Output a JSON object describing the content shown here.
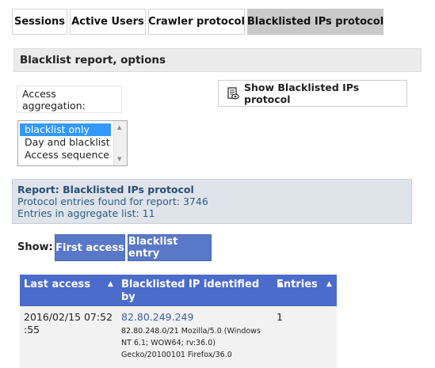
{
  "tabs": [
    {
      "label": "Sessions"
    },
    {
      "label": "Active Users"
    },
    {
      "label": "Crawler protocol"
    },
    {
      "label": "Blacklisted IPs protocol"
    }
  ],
  "section": {
    "title": "Blacklist report, options"
  },
  "aggregation": {
    "label": "Access aggregation:",
    "options": [
      "blacklist only",
      "Day and blacklist",
      "Access sequence"
    ],
    "selected": "blacklist only"
  },
  "show_button": {
    "label": "Show Blacklisted IPs protocol",
    "icon": "protocol-view-icon"
  },
  "report": {
    "title": "Report: Blacklisted IPs protocol",
    "entries_found": "Protocol entries found for report: 3746",
    "aggregate_entries": "Entries in aggregate list: 11"
  },
  "show_controls": {
    "label": "Show:",
    "first_access": "First access",
    "blacklist_entry": "Blacklist entry"
  },
  "table": {
    "headers": {
      "last_access": "Last access",
      "ip_line1": "Blacklisted IP identified",
      "ip_line2": "by",
      "entries": "Entries"
    },
    "rows": [
      {
        "date_line1": "2016/02/15 07:52",
        "date_line2": ":55",
        "ip": "82.80.249.249",
        "detail": [
          "82.80.248.0/21 Mozilla/5.0 (Windows",
          "NT 6.1; WOW64; rv:36.0)",
          "Gecko/20100101 Firefox/36.0"
        ],
        "entries": "1"
      }
    ]
  }
}
